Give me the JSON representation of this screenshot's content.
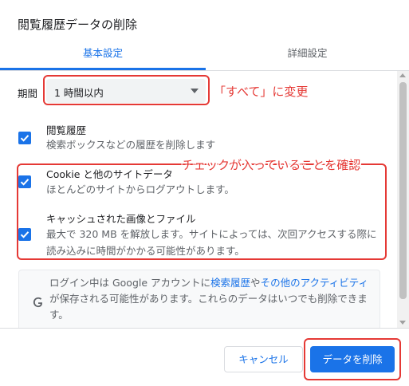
{
  "dialog": {
    "title": "閲覧履歴データの削除"
  },
  "tabs": [
    {
      "label": "基本設定",
      "active": true
    },
    {
      "label": "詳細設定",
      "active": false
    }
  ],
  "period": {
    "label": "期間",
    "selected": "1 時間以内"
  },
  "options": [
    {
      "title": "閲覧履歴",
      "desc": "検索ボックスなどの履歴を削除します",
      "checked": true
    },
    {
      "title": "Cookie と他のサイトデータ",
      "desc": "ほとんどのサイトからログアウトします。",
      "checked": true
    },
    {
      "title": "キャッシュされた画像とファイル",
      "desc": "最大で 320 MB を解放します。サイトによっては、次回アクセスする際に読み込みに時間がかかる可能性があります。",
      "checked": true
    }
  ],
  "info": {
    "text_before": "ログイン中は Google アカウントに",
    "link1": "検索履歴",
    "text_mid": "や",
    "link2": "その他のアクティビティ",
    "text_after": "が保存される可能性があります。これらのデータはいつでも削除できます。"
  },
  "buttons": {
    "cancel": "キャンセル",
    "delete": "データを削除"
  },
  "annotations": {
    "select_note": "「すべて」に変更",
    "items_note": "チェックが入っていることを確認"
  },
  "colors": {
    "accent": "#1a73e8",
    "annotation": "#e53935"
  }
}
